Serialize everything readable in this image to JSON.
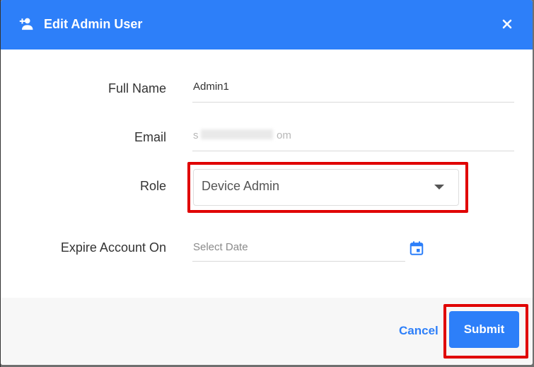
{
  "dialog": {
    "title": "Edit Admin User",
    "header_icon": "person-add-icon",
    "close_icon": "close-icon",
    "header_color": "#2d7ff9"
  },
  "form": {
    "full_name": {
      "label": "Full Name",
      "value": "Admin1"
    },
    "email": {
      "label": "Email",
      "value_prefix": "s",
      "value_suffix": "om"
    },
    "role": {
      "label": "Role",
      "value": "Device Admin"
    },
    "expire": {
      "label": "Expire Account On",
      "placeholder": "Select Date",
      "icon": "calendar-icon"
    }
  },
  "footer": {
    "cancel_label": "Cancel",
    "submit_label": "Submit"
  },
  "colors": {
    "accent": "#2d7ff9",
    "highlight": "#e00000"
  }
}
